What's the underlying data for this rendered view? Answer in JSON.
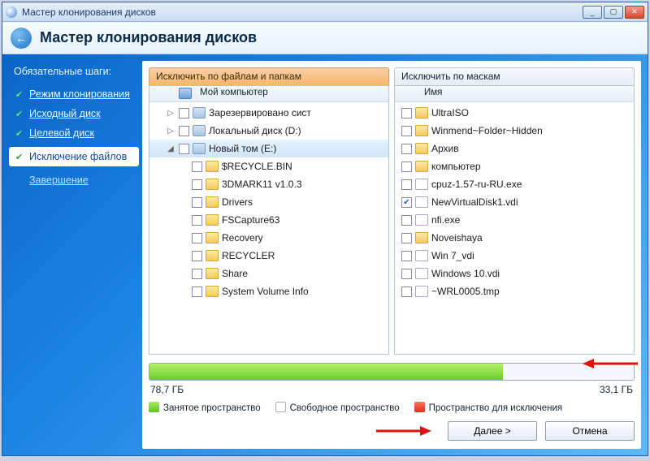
{
  "window": {
    "title": "Мастер клонирования дисков"
  },
  "header": {
    "title": "Мастер клонирования дисков"
  },
  "sidebar": {
    "title": "Обязательные шаги:",
    "steps": [
      {
        "label": "Режим клонирования",
        "state": "done"
      },
      {
        "label": "Исходный диск",
        "state": "done"
      },
      {
        "label": "Целевой диск",
        "state": "done"
      },
      {
        "label": "Исключение файлов",
        "state": "current"
      },
      {
        "label": "Завершение",
        "state": "future"
      }
    ]
  },
  "tabs": {
    "left": "Исключить по файлам и папкам",
    "right": "Исключить по маскам"
  },
  "left_header": {
    "c1": "",
    "c2": "Мой компьютер"
  },
  "right_header": {
    "c1": "",
    "c2": "Имя"
  },
  "tree": [
    {
      "depth": 1,
      "exp": "▷",
      "icon": "drive",
      "label": "Зарезервировано сист"
    },
    {
      "depth": 1,
      "exp": "▷",
      "icon": "drive",
      "label": "Локальный диск (D:)"
    },
    {
      "depth": 1,
      "exp": "◢",
      "icon": "drive",
      "label": "Новый том (E:)",
      "sel": true
    },
    {
      "depth": 2,
      "exp": "",
      "icon": "folder",
      "label": "$RECYCLE.BIN"
    },
    {
      "depth": 2,
      "exp": "",
      "icon": "folder",
      "label": "3DMARK11 v1.0.3"
    },
    {
      "depth": 2,
      "exp": "",
      "icon": "folder",
      "label": "Drivers"
    },
    {
      "depth": 2,
      "exp": "",
      "icon": "folder",
      "label": "FSCapture63"
    },
    {
      "depth": 2,
      "exp": "",
      "icon": "folder",
      "label": "Recovery"
    },
    {
      "depth": 2,
      "exp": "",
      "icon": "folder",
      "label": "RECYCLER"
    },
    {
      "depth": 2,
      "exp": "",
      "icon": "folder",
      "label": "Share"
    },
    {
      "depth": 2,
      "exp": "",
      "icon": "folder",
      "label": "System Volume Info"
    }
  ],
  "files": [
    {
      "icon": "folder",
      "label": "UltraISO"
    },
    {
      "icon": "folder",
      "label": "Winmend~Folder~Hidden"
    },
    {
      "icon": "folder",
      "label": "Архив"
    },
    {
      "icon": "folder",
      "label": "компьютер"
    },
    {
      "icon": "file",
      "label": "cpuz-1.57-ru-RU.exe"
    },
    {
      "icon": "file",
      "label": "NewVirtualDisk1.vdi",
      "checked": true
    },
    {
      "icon": "file",
      "label": "nfi.exe"
    },
    {
      "icon": "folder",
      "label": "Noveishaya"
    },
    {
      "icon": "file",
      "label": "Win 7_vdi"
    },
    {
      "icon": "file",
      "label": "Windows 10.vdi"
    },
    {
      "icon": "file",
      "label": "~WRL0005.tmp"
    }
  ],
  "disk": {
    "used_pct": 73,
    "used_label": "78,7 ГБ",
    "free_label": "33,1 ГБ"
  },
  "legend": {
    "used": "Занятое пространство",
    "free": "Свободное пространство",
    "excl": "Пространство для исключения"
  },
  "buttons": {
    "next": "Далее >",
    "cancel": "Отмена"
  }
}
